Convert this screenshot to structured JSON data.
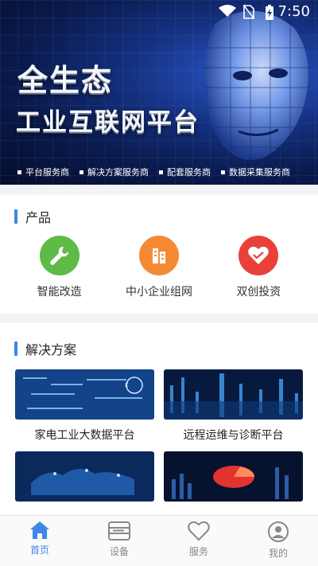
{
  "status_bar": {
    "time": "7:50"
  },
  "hero": {
    "title_line1": "全生态",
    "title_line2": "工业互联网平台",
    "tags": [
      "平台服务商",
      "解决方案服务商",
      "配套服务商",
      "数据采集服务商"
    ]
  },
  "products": {
    "title": "产品",
    "items": [
      {
        "label": "智能改造",
        "icon": "wrench-icon",
        "color": "#5dbb46"
      },
      {
        "label": "中小企业组网",
        "icon": "building-icon",
        "color": "#f58a35"
      },
      {
        "label": "双创投资",
        "icon": "handshake-icon",
        "color": "#e9413a"
      }
    ]
  },
  "solutions": {
    "title": "解决方案",
    "items": [
      {
        "label": "家电工业大数据平台"
      },
      {
        "label": "远程运维与诊断平台"
      },
      {
        "label": ""
      },
      {
        "label": ""
      }
    ]
  },
  "tabbar": {
    "items": [
      {
        "label": "首页",
        "icon": "home-icon",
        "active": true
      },
      {
        "label": "设备",
        "icon": "server-icon",
        "active": false
      },
      {
        "label": "服务",
        "icon": "heart-icon",
        "active": false
      },
      {
        "label": "我的",
        "icon": "user-icon",
        "active": false
      }
    ]
  },
  "colors": {
    "accent": "#3f86e8",
    "inactive": "#888888"
  }
}
